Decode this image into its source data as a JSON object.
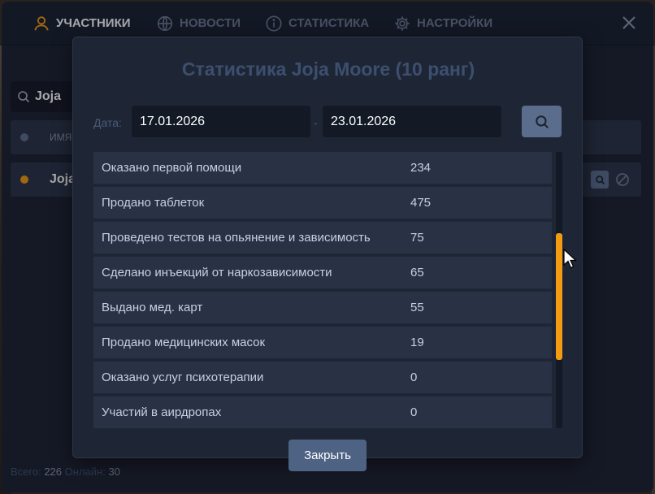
{
  "nav": {
    "tabs": [
      {
        "label": "Участники",
        "icon": "user-icon",
        "active": true
      },
      {
        "label": "Новости",
        "icon": "globe-icon",
        "active": false
      },
      {
        "label": "Статистика",
        "icon": "info-icon",
        "active": false
      },
      {
        "label": "Настройки",
        "icon": "gear-icon",
        "active": false
      }
    ],
    "close_icon": "close-icon"
  },
  "members": {
    "search_value": "Joja",
    "header_name": "имя",
    "row_name": "Joja",
    "status_color_header": "#5b6f8e",
    "status_color_row": "#f39c12",
    "footer": {
      "total_label": "Всего:",
      "total_value": "226",
      "online_label": "Онлайн:",
      "online_value": "30"
    }
  },
  "modal": {
    "title": "Статистика Joja Moore (10 ранг)",
    "date_label": "Дата:",
    "date_from": "17.01.2026",
    "date_sep": "-",
    "date_to": "23.01.2026",
    "close_label": "Закрыть",
    "stats": [
      {
        "label": "Оказано первой помощи",
        "value": "234"
      },
      {
        "label": "Продано таблеток",
        "value": "475"
      },
      {
        "label": "Проведено тестов на опьянение и зависимость",
        "value": "75"
      },
      {
        "label": "Сделано инъекций от наркозависимости",
        "value": "65"
      },
      {
        "label": "Выдано мед. карт",
        "value": "55"
      },
      {
        "label": "Продано медицинских масок",
        "value": "19"
      },
      {
        "label": "Оказано услуг психотерапии",
        "value": "0"
      },
      {
        "label": "Участий в аирдропах",
        "value": "0"
      }
    ]
  },
  "colors": {
    "accent": "#f39c12",
    "button": "#5a6d8c"
  }
}
